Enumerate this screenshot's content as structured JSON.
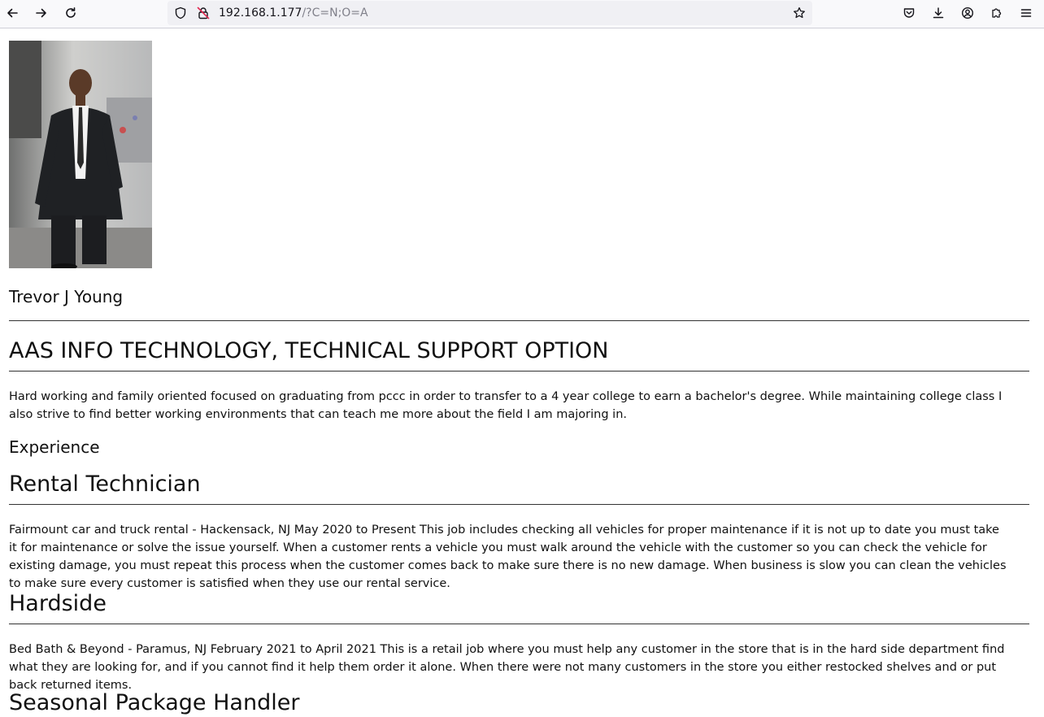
{
  "browser": {
    "url_host": "192.168.1.177",
    "url_path": "/?C=N;O=A"
  },
  "profile": {
    "name": "Trevor J Young",
    "headline": "AAS INFO TECHNOLOGY, TECHNICAL SUPPORT OPTION",
    "summary": "Hard working and family oriented focused on graduating from pccc in order to transfer to a 4 year college to earn a bachelor's degree. While maintaining college class I also strive to find better working environments that can teach me more about the field I am majoring in."
  },
  "experience": {
    "heading": "Experience",
    "jobs": [
      {
        "title": "Rental Technician",
        "description": "Fairmount car and truck rental - Hackensack, NJ May 2020 to Present This job includes checking all vehicles for proper maintenance if it is not up to date you must take it for maintenance or solve the issue yourself. When a customer rents a vehicle you must walk around the vehicle with the customer so you can check the vehicle for existing damage, you must repeat this process when the customer comes back to make sure there is no new damage. When business is slow you can clean the vehicles to make sure every customer is satisfied when they use our rental service."
      },
      {
        "title": "Hardside",
        "description": "Bed Bath & Beyond - Paramus, NJ February 2021 to April 2021 This is a retail job where you must help any customer in the store that is in the hard side department find what they are looking for, and if you cannot find it help them order it alone. When there were not many customers in the store you either restocked shelves and or put back returned items."
      },
      {
        "title": "Seasonal Package Handler"
      }
    ]
  },
  "icons": {
    "back": "back-arrow-icon",
    "forward": "forward-arrow-icon",
    "reload": "reload-icon",
    "tracking": "shield-icon",
    "insecure": "insecure-lock-icon",
    "bookmark": "star-icon",
    "pocket": "pocket-icon",
    "downloads": "download-icon",
    "account": "account-icon",
    "extensions": "puzzle-icon",
    "menu": "hamburger-menu-icon"
  }
}
